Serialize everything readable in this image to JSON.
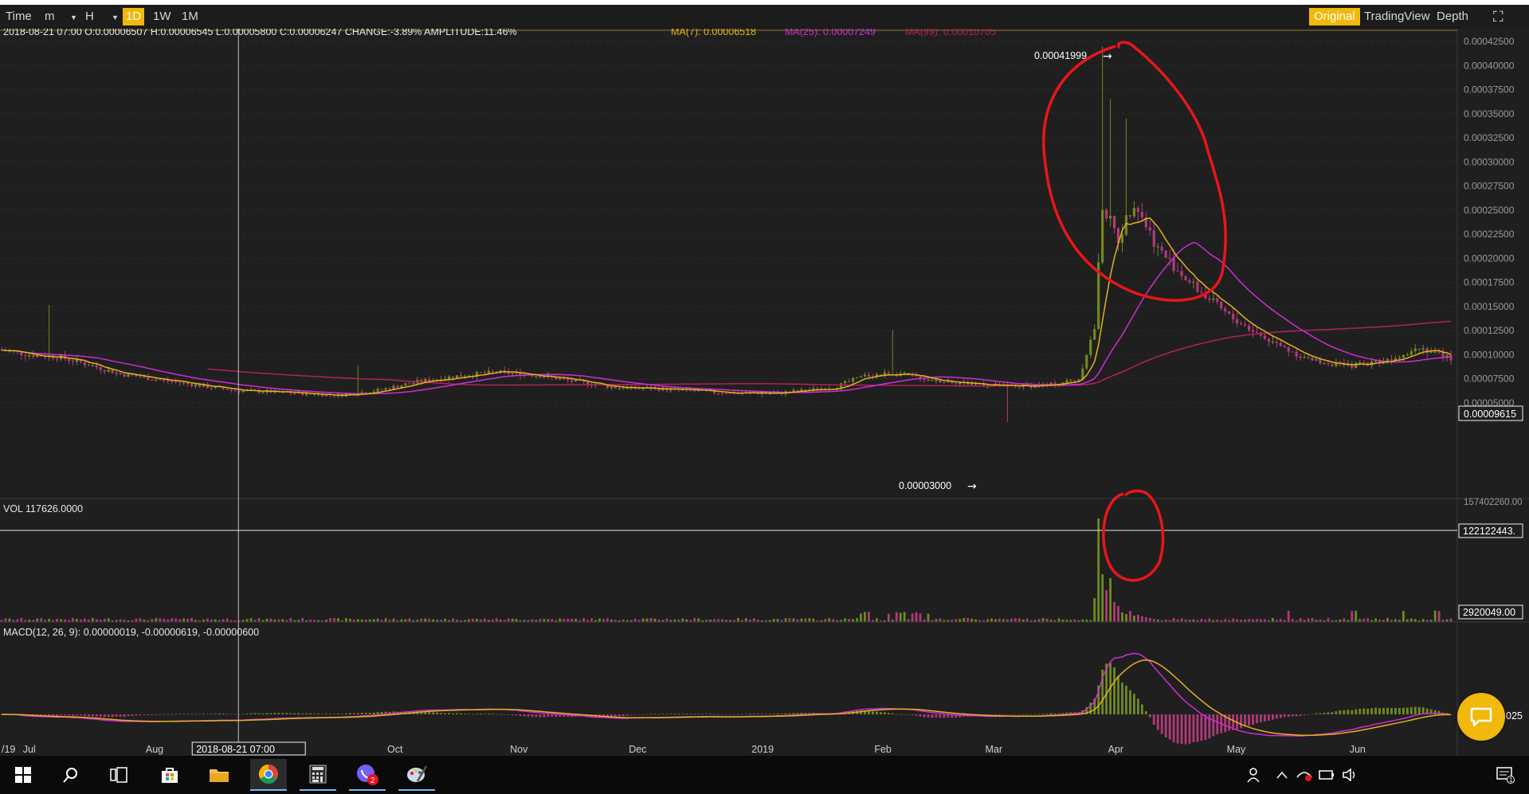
{
  "toolbar": {
    "time_label": "Time",
    "minute_label": "m",
    "hour_label": "H",
    "active_interval": "1D",
    "week_label": "1W",
    "month_label": "1M",
    "original_label": "Original",
    "tradingview_label": "TradingView",
    "depth_label": "Depth",
    "dropdown_glyph": "▼",
    "fullscreen_glyph": "⛶"
  },
  "info_bar": {
    "ohlc": "2018-08-21 07:00  O:0.00006507 H:0.00006545 L:0.00005800 C:0.00006247 CHANGE:-3.89% AMPLITUDE:11.46%",
    "ma7": "MA(7): 0.00006518",
    "ma25": "MA(25): 0.00007249",
    "ma99": "MA(99): 0.00010705"
  },
  "annotations": {
    "high_label": "0.00041999",
    "low_label": "0.00003000",
    "arrow_glyph": "→"
  },
  "price_axis": {
    "ticks": [
      "0.00042500",
      "0.00040000",
      "0.00037500",
      "0.00035000",
      "0.00032500",
      "0.00030000",
      "0.00027500",
      "0.00025000",
      "0.00022500",
      "0.00020000",
      "0.00017500",
      "0.00015000",
      "0.00012500",
      "0.00010000",
      "0.00007500",
      "0.00005000"
    ],
    "tick_values": [
      0.000425,
      0.0004,
      0.000375,
      0.00035,
      0.000325,
      0.0003,
      0.000275,
      0.00025,
      0.000225,
      0.0002,
      0.000175,
      0.00015,
      0.000125,
      0.0001,
      7.5e-05,
      5e-05
    ],
    "current_price": "0.00009615",
    "current_value": 9.615e-05
  },
  "volume_panel": {
    "label": "VOL 117626.0000",
    "axis_top": "157402260.00",
    "crosshair_value": "122122443.",
    "current_value": "2920049.00"
  },
  "macd_panel": {
    "label": "MACD(12, 26, 9): 0.00000019, -0.00000619, -0.00000600",
    "right_value": "025"
  },
  "time_axis": {
    "ticks": [
      {
        "label": "/19",
        "index": 0
      },
      {
        "label": "Jul",
        "index": 7
      },
      {
        "label": "Aug",
        "index": 38
      },
      {
        "label": "Oct",
        "index": 99
      },
      {
        "label": "Nov",
        "index": 130
      },
      {
        "label": "Dec",
        "index": 160
      },
      {
        "label": "2019",
        "index": 191
      },
      {
        "label": "Feb",
        "index": 222
      },
      {
        "label": "Mar",
        "index": 250
      },
      {
        "label": "Apr",
        "index": 281
      },
      {
        "label": "May",
        "index": 311
      },
      {
        "label": "Jun",
        "index": 342
      }
    ],
    "crosshair_label": "2018-08-21 07:00",
    "crosshair_index": 59
  },
  "colors": {
    "background": "#1f1f1f",
    "up": "#6f8a1f",
    "down": "#b03a7a",
    "ma7": "#e3b21d",
    "ma25": "#d12bd6",
    "ma99": "#b3205f",
    "accent": "#f0b90b",
    "annotation": "#e8161a"
  },
  "chart_data": {
    "type": "candlestick",
    "series": [
      {
        "name": "MA(7)"
      },
      {
        "name": "MA(25)"
      },
      {
        "name": "MA(99)"
      }
    ],
    "x_range": [
      "2018-06-23",
      "2019-06-27"
    ],
    "ylim": [
      3e-05,
      0.00042999
    ],
    "key_points": [
      {
        "x": "2018-08-21",
        "open": 6.507e-05,
        "high": 6.545e-05,
        "low": 5.8e-05,
        "close": 6.247e-05
      },
      {
        "x": "2019-03-04",
        "low": 3e-05
      },
      {
        "x": "2019-03-27",
        "high": 0.00041999
      }
    ],
    "price_path": [
      [
        0,
        0.000105
      ],
      [
        7,
        0.0001
      ],
      [
        14,
        9.8e-05
      ],
      [
        20,
        9.2e-05
      ],
      [
        30,
        8e-05
      ],
      [
        40,
        7.4e-05
      ],
      [
        50,
        6.8e-05
      ],
      [
        59,
        6.3e-05
      ],
      [
        70,
        6.1e-05
      ],
      [
        85,
        5.8e-05
      ],
      [
        95,
        6.3e-05
      ],
      [
        105,
        7.2e-05
      ],
      [
        115,
        7.8e-05
      ],
      [
        125,
        8.2e-05
      ],
      [
        135,
        7.9e-05
      ],
      [
        145,
        7.2e-05
      ],
      [
        155,
        6.6e-05
      ],
      [
        165,
        6.5e-05
      ],
      [
        180,
        6.1e-05
      ],
      [
        195,
        6e-05
      ],
      [
        210,
        6.6e-05
      ],
      [
        218,
        7.8e-05
      ],
      [
        225,
        8.1e-05
      ],
      [
        235,
        7.4e-05
      ],
      [
        245,
        7e-05
      ],
      [
        255,
        6.7e-05
      ],
      [
        265,
        6.9e-05
      ],
      [
        272,
        7.5e-05
      ],
      [
        276,
        0.000128
      ],
      [
        278,
        0.000255
      ],
      [
        282,
        0.00022
      ],
      [
        286,
        0.00026
      ],
      [
        292,
        0.00021
      ],
      [
        300,
        0.000175
      ],
      [
        310,
        0.00014
      ],
      [
        320,
        0.000115
      ],
      [
        330,
        9.5e-05
      ],
      [
        340,
        8.8e-05
      ],
      [
        350,
        9.5e-05
      ],
      [
        358,
        0.000108
      ],
      [
        366,
        9.6e-05
      ]
    ],
    "volume_note": "volume spike at 2019-03-27 near 157402260"
  }
}
